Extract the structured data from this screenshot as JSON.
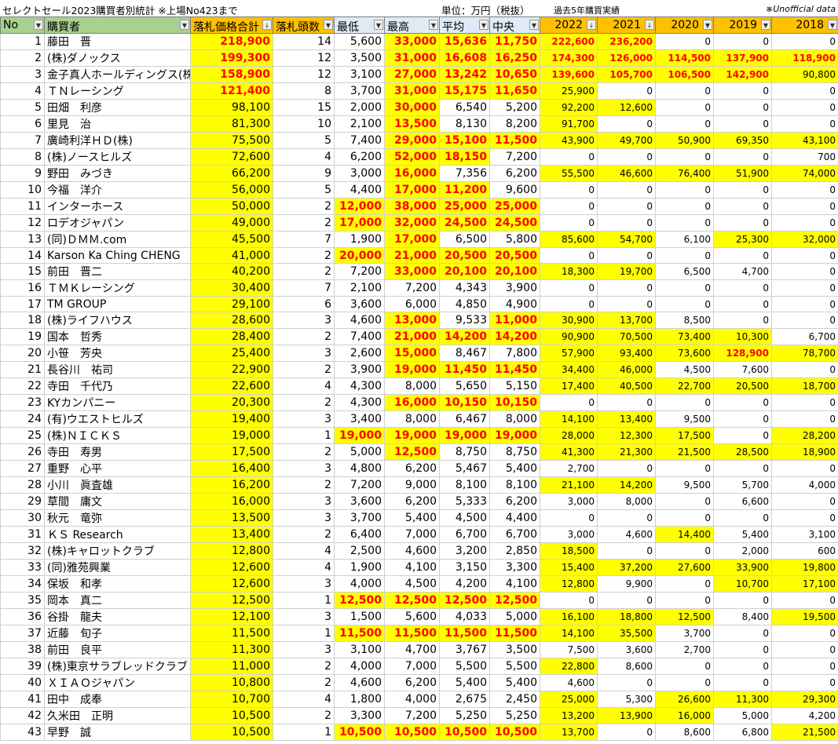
{
  "title": "セレクトセール2023購買者別統計 ※上場No423まで",
  "unit_label": "単位：万円（税抜）",
  "past_label": "過去5年購買実績",
  "unofficial": "※Unofficial data",
  "filter_icon": "dropdown-arrow-icon",
  "headers": [
    "No",
    "購買者",
    "落札価格合計",
    "落札頭数",
    "最低",
    "最高",
    "平均",
    "中央",
    "2022",
    "2021",
    "2020",
    "2019",
    "2018"
  ],
  "rows": [
    {
      "no": "1",
      "name": "藤田　晋",
      "total": "218,900",
      "count": "14",
      "min": "5,600",
      "max": "33,000",
      "avg": "15,636",
      "med": "11,750",
      "y2022": "222,600",
      "y2021": "236,200",
      "y2020": "0",
      "y2019": "0",
      "y2018": "0"
    },
    {
      "no": "2",
      "name": "(株)ダノックス",
      "total": "199,300",
      "count": "12",
      "min": "3,500",
      "max": "31,000",
      "avg": "16,608",
      "med": "16,250",
      "y2022": "174,300",
      "y2021": "126,000",
      "y2020": "114,500",
      "y2019": "137,900",
      "y2018": "118,900"
    },
    {
      "no": "3",
      "name": "金子真人ホールディングス(株)",
      "total": "158,900",
      "count": "12",
      "min": "3,100",
      "max": "27,000",
      "avg": "13,242",
      "med": "10,650",
      "y2022": "139,600",
      "y2021": "105,700",
      "y2020": "106,500",
      "y2019": "142,900",
      "y2018": "90,800"
    },
    {
      "no": "4",
      "name": "ＴＮレーシング",
      "total": "121,400",
      "count": "8",
      "min": "3,700",
      "max": "31,000",
      "avg": "15,175",
      "med": "11,650",
      "y2022": "25,900",
      "y2021": "0",
      "y2020": "0",
      "y2019": "0",
      "y2018": "0"
    },
    {
      "no": "5",
      "name": "田畑　利彦",
      "total": "98,100",
      "count": "15",
      "min": "2,000",
      "max": "30,000",
      "avg": "6,540",
      "med": "5,200",
      "y2022": "92,200",
      "y2021": "12,600",
      "y2020": "0",
      "y2019": "0",
      "y2018": "0"
    },
    {
      "no": "6",
      "name": "里見　治",
      "total": "81,300",
      "count": "10",
      "min": "2,100",
      "max": "13,500",
      "avg": "8,130",
      "med": "8,200",
      "y2022": "91,700",
      "y2021": "0",
      "y2020": "0",
      "y2019": "0",
      "y2018": "0"
    },
    {
      "no": "7",
      "name": "廣崎利洋ＨＤ(株)",
      "total": "75,500",
      "count": "5",
      "min": "7,400",
      "max": "29,000",
      "avg": "15,100",
      "med": "11,500",
      "y2022": "43,900",
      "y2021": "49,700",
      "y2020": "50,900",
      "y2019": "69,350",
      "y2018": "43,100"
    },
    {
      "no": "8",
      "name": "(株)ノースヒルズ",
      "total": "72,600",
      "count": "4",
      "min": "6,200",
      "max": "52,000",
      "avg": "18,150",
      "med": "7,200",
      "y2022": "0",
      "y2021": "0",
      "y2020": "0",
      "y2019": "0",
      "y2018": "700"
    },
    {
      "no": "9",
      "name": "野田　みづき",
      "total": "66,200",
      "count": "9",
      "min": "3,000",
      "max": "16,000",
      "avg": "7,356",
      "med": "6,200",
      "y2022": "55,500",
      "y2021": "46,600",
      "y2020": "76,400",
      "y2019": "51,900",
      "y2018": "74,000"
    },
    {
      "no": "10",
      "name": "今福　洋介",
      "total": "56,000",
      "count": "5",
      "min": "4,400",
      "max": "17,000",
      "avg": "11,200",
      "med": "9,600",
      "y2022": "0",
      "y2021": "0",
      "y2020": "0",
      "y2019": "0",
      "y2018": "0"
    },
    {
      "no": "11",
      "name": "インターホース",
      "total": "50,000",
      "count": "2",
      "min": "12,000",
      "max": "38,000",
      "avg": "25,000",
      "med": "25,000",
      "y2022": "0",
      "y2021": "0",
      "y2020": "0",
      "y2019": "0",
      "y2018": "0"
    },
    {
      "no": "12",
      "name": "ロデオジャパン",
      "total": "49,000",
      "count": "2",
      "min": "17,000",
      "max": "32,000",
      "avg": "24,500",
      "med": "24,500",
      "y2022": "0",
      "y2021": "0",
      "y2020": "0",
      "y2019": "0",
      "y2018": "0"
    },
    {
      "no": "13",
      "name": "(同)ＤＭＭ.com",
      "total": "45,500",
      "count": "7",
      "min": "1,900",
      "max": "17,000",
      "avg": "6,500",
      "med": "5,800",
      "y2022": "85,600",
      "y2021": "54,700",
      "y2020": "6,100",
      "y2019": "25,300",
      "y2018": "32,000"
    },
    {
      "no": "14",
      "name": "Karson Ka Ching CHENG",
      "total": "41,000",
      "count": "2",
      "min": "20,000",
      "max": "21,000",
      "avg": "20,500",
      "med": "20,500",
      "y2022": "0",
      "y2021": "0",
      "y2020": "0",
      "y2019": "0",
      "y2018": "0"
    },
    {
      "no": "15",
      "name": "前田　晋二",
      "total": "40,200",
      "count": "2",
      "min": "7,200",
      "max": "33,000",
      "avg": "20,100",
      "med": "20,100",
      "y2022": "18,300",
      "y2021": "19,700",
      "y2020": "6,500",
      "y2019": "4,700",
      "y2018": "0"
    },
    {
      "no": "16",
      "name": "ＴＭＫレーシング",
      "total": "30,400",
      "count": "7",
      "min": "2,100",
      "max": "7,200",
      "avg": "4,343",
      "med": "3,900",
      "y2022": "0",
      "y2021": "0",
      "y2020": "0",
      "y2019": "0",
      "y2018": "0"
    },
    {
      "no": "17",
      "name": "TM GROUP",
      "total": "29,100",
      "count": "6",
      "min": "3,600",
      "max": "6,000",
      "avg": "4,850",
      "med": "4,900",
      "y2022": "0",
      "y2021": "0",
      "y2020": "0",
      "y2019": "0",
      "y2018": "0"
    },
    {
      "no": "18",
      "name": "(株)ライフハウス",
      "total": "28,600",
      "count": "3",
      "min": "4,600",
      "max": "13,000",
      "avg": "9,533",
      "med": "11,000",
      "y2022": "30,900",
      "y2021": "13,700",
      "y2020": "8,500",
      "y2019": "0",
      "y2018": "0"
    },
    {
      "no": "19",
      "name": "国本　哲秀",
      "total": "28,400",
      "count": "2",
      "min": "7,400",
      "max": "21,000",
      "avg": "14,200",
      "med": "14,200",
      "y2022": "90,900",
      "y2021": "70,500",
      "y2020": "73,400",
      "y2019": "10,300",
      "y2018": "6,700"
    },
    {
      "no": "20",
      "name": "小笹　芳央",
      "total": "25,400",
      "count": "3",
      "min": "2,600",
      "max": "15,000",
      "avg": "8,467",
      "med": "7,800",
      "y2022": "57,900",
      "y2021": "93,400",
      "y2020": "73,600",
      "y2019": "128,900",
      "y2018": "78,700"
    },
    {
      "no": "21",
      "name": "長谷川　祐司",
      "total": "22,900",
      "count": "2",
      "min": "3,900",
      "max": "19,000",
      "avg": "11,450",
      "med": "11,450",
      "y2022": "34,400",
      "y2021": "46,000",
      "y2020": "4,500",
      "y2019": "7,600",
      "y2018": "0"
    },
    {
      "no": "22",
      "name": "寺田　千代乃",
      "total": "22,600",
      "count": "4",
      "min": "4,300",
      "max": "8,000",
      "avg": "5,650",
      "med": "5,150",
      "y2022": "17,400",
      "y2021": "40,500",
      "y2020": "22,700",
      "y2019": "20,500",
      "y2018": "18,700"
    },
    {
      "no": "23",
      "name": "KYカンパニー",
      "total": "20,300",
      "count": "2",
      "min": "4,300",
      "max": "16,000",
      "avg": "10,150",
      "med": "10,150",
      "y2022": "0",
      "y2021": "0",
      "y2020": "0",
      "y2019": "0",
      "y2018": "0"
    },
    {
      "no": "24",
      "name": "(有)ウエストヒルズ",
      "total": "19,400",
      "count": "3",
      "min": "3,400",
      "max": "8,000",
      "avg": "6,467",
      "med": "8,000",
      "y2022": "14,100",
      "y2021": "13,400",
      "y2020": "9,500",
      "y2019": "0",
      "y2018": "0"
    },
    {
      "no": "25",
      "name": "(株)ＮＩＣＫＳ",
      "total": "19,000",
      "count": "1",
      "min": "19,000",
      "max": "19,000",
      "avg": "19,000",
      "med": "19,000",
      "y2022": "28,000",
      "y2021": "12,300",
      "y2020": "17,500",
      "y2019": "0",
      "y2018": "28,200"
    },
    {
      "no": "26",
      "name": "寺田　寿男",
      "total": "17,500",
      "count": "2",
      "min": "5,000",
      "max": "12,500",
      "avg": "8,750",
      "med": "8,750",
      "y2022": "41,300",
      "y2021": "21,300",
      "y2020": "21,500",
      "y2019": "28,500",
      "y2018": "18,900"
    },
    {
      "no": "27",
      "name": "重野　心平",
      "total": "16,400",
      "count": "3",
      "min": "4,800",
      "max": "6,200",
      "avg": "5,467",
      "med": "5,400",
      "y2022": "2,700",
      "y2021": "0",
      "y2020": "0",
      "y2019": "0",
      "y2018": "0"
    },
    {
      "no": "28",
      "name": "小川　眞査雄",
      "total": "16,200",
      "count": "2",
      "min": "7,200",
      "max": "9,000",
      "avg": "8,100",
      "med": "8,100",
      "y2022": "21,100",
      "y2021": "14,200",
      "y2020": "9,500",
      "y2019": "5,700",
      "y2018": "4,000"
    },
    {
      "no": "29",
      "name": "草間　庸文",
      "total": "16,000",
      "count": "3",
      "min": "3,600",
      "max": "6,200",
      "avg": "5,333",
      "med": "6,200",
      "y2022": "3,000",
      "y2021": "8,000",
      "y2020": "0",
      "y2019": "6,600",
      "y2018": "0"
    },
    {
      "no": "30",
      "name": "秋元　竜弥",
      "total": "13,500",
      "count": "3",
      "min": "3,700",
      "max": "5,400",
      "avg": "4,500",
      "med": "4,400",
      "y2022": "0",
      "y2021": "0",
      "y2020": "0",
      "y2019": "0",
      "y2018": "0"
    },
    {
      "no": "31",
      "name": "ＫＳ Research",
      "total": "13,400",
      "count": "2",
      "min": "6,400",
      "max": "7,000",
      "avg": "6,700",
      "med": "6,700",
      "y2022": "3,000",
      "y2021": "4,600",
      "y2020": "14,400",
      "y2019": "5,400",
      "y2018": "3,100"
    },
    {
      "no": "32",
      "name": "(株)キャロットクラブ",
      "total": "12,800",
      "count": "4",
      "min": "2,500",
      "max": "4,600",
      "avg": "3,200",
      "med": "2,850",
      "y2022": "18,500",
      "y2021": "0",
      "y2020": "0",
      "y2019": "2,000",
      "y2018": "600"
    },
    {
      "no": "33",
      "name": "(同)雅苑興業",
      "total": "12,600",
      "count": "4",
      "min": "1,900",
      "max": "4,100",
      "avg": "3,150",
      "med": "3,300",
      "y2022": "15,400",
      "y2021": "37,200",
      "y2020": "27,600",
      "y2019": "33,900",
      "y2018": "19,800"
    },
    {
      "no": "34",
      "name": "保坂　和孝",
      "total": "12,600",
      "count": "3",
      "min": "4,000",
      "max": "4,500",
      "avg": "4,200",
      "med": "4,100",
      "y2022": "12,800",
      "y2021": "9,900",
      "y2020": "0",
      "y2019": "10,700",
      "y2018": "17,100"
    },
    {
      "no": "35",
      "name": "岡本　真二",
      "total": "12,500",
      "count": "1",
      "min": "12,500",
      "max": "12,500",
      "avg": "12,500",
      "med": "12,500",
      "y2022": "0",
      "y2021": "0",
      "y2020": "0",
      "y2019": "0",
      "y2018": "0"
    },
    {
      "no": "36",
      "name": "谷掛　龍夫",
      "total": "12,100",
      "count": "3",
      "min": "1,500",
      "max": "5,600",
      "avg": "4,033",
      "med": "5,000",
      "y2022": "16,100",
      "y2021": "18,800",
      "y2020": "12,500",
      "y2019": "8,400",
      "y2018": "19,500"
    },
    {
      "no": "37",
      "name": "近藤　旬子",
      "total": "11,500",
      "count": "1",
      "min": "11,500",
      "max": "11,500",
      "avg": "11,500",
      "med": "11,500",
      "y2022": "14,100",
      "y2021": "35,500",
      "y2020": "3,700",
      "y2019": "0",
      "y2018": "0"
    },
    {
      "no": "38",
      "name": "前田　良平",
      "total": "11,300",
      "count": "3",
      "min": "3,100",
      "max": "4,700",
      "avg": "3,767",
      "med": "3,500",
      "y2022": "7,500",
      "y2021": "3,600",
      "y2020": "2,700",
      "y2019": "0",
      "y2018": "0"
    },
    {
      "no": "39",
      "name": "(株)東京サラブレッドクラブ",
      "total": "11,000",
      "count": "2",
      "min": "4,000",
      "max": "7,000",
      "avg": "5,500",
      "med": "5,500",
      "y2022": "22,800",
      "y2021": "8,600",
      "y2020": "0",
      "y2019": "0",
      "y2018": "0"
    },
    {
      "no": "40",
      "name": "ＸＩＡＯジャパン",
      "total": "10,800",
      "count": "2",
      "min": "4,600",
      "max": "6,200",
      "avg": "5,400",
      "med": "5,400",
      "y2022": "4,600",
      "y2021": "0",
      "y2020": "0",
      "y2019": "0",
      "y2018": "0"
    },
    {
      "no": "41",
      "name": "田中　成奉",
      "total": "10,700",
      "count": "4",
      "min": "1,800",
      "max": "4,000",
      "avg": "2,675",
      "med": "2,450",
      "y2022": "25,000",
      "y2021": "5,300",
      "y2020": "26,600",
      "y2019": "11,300",
      "y2018": "29,300"
    },
    {
      "no": "42",
      "name": "久米田　正明",
      "total": "10,500",
      "count": "2",
      "min": "3,300",
      "max": "7,200",
      "avg": "5,250",
      "med": "5,250",
      "y2022": "13,200",
      "y2021": "13,900",
      "y2020": "16,000",
      "y2019": "5,000",
      "y2018": "4,200"
    },
    {
      "no": "43",
      "name": "早野　誠",
      "total": "10,500",
      "count": "1",
      "min": "10,500",
      "max": "10,500",
      "avg": "10,500",
      "med": "10,500",
      "y2022": "13,700",
      "y2021": "0",
      "y2020": "8,600",
      "y2019": "6,800",
      "y2018": "21,500"
    }
  ]
}
